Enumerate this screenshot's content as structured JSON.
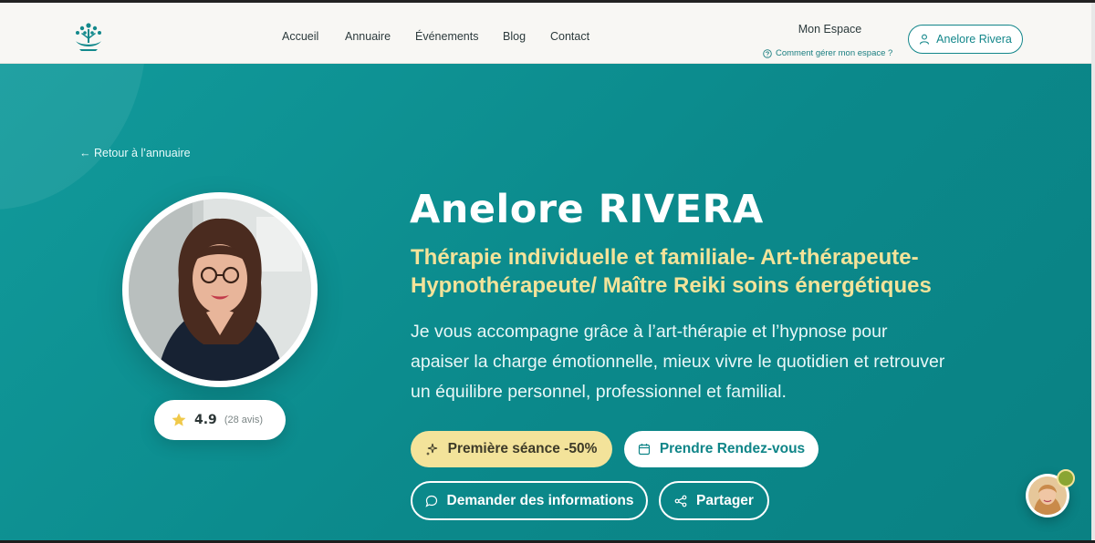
{
  "nav": {
    "links": [
      "Accueil",
      "Annuaire",
      "Événements",
      "Blog",
      "Contact"
    ],
    "espace_title": "Mon Espace",
    "espace_help": "Comment gérer mon espace ?",
    "user_button": "Anelore Rivera"
  },
  "hero": {
    "back_link": "← Retour à l’annuaire",
    "name": "Anelore RIVERA",
    "specialty": "Thérapie individuelle et familiale- Art-thérapeute- Hypnothérapeute/ Maître Reiki soins énergétiques",
    "description": "Je vous accompagne grâce à l’art-thérapie et l’hypnose pour apaiser la charge émotionnelle, mieux vivre le quotidien et retrouver un équilibre personnel, professionnel et familial.",
    "rating": {
      "value": "4.9",
      "count": "(28 avis)"
    },
    "buttons": {
      "offer": "Première séance -50%",
      "appointment": "Prendre Rendez-vous",
      "info": "Demander des informations",
      "share": "Partager"
    }
  },
  "colors": {
    "teal": "#0c8f91",
    "accent_yellow": "#f3e39a",
    "nav_bg": "#f8f7f4"
  },
  "icons": {
    "logo": "lotus-tree-logo",
    "help": "question-circle-icon",
    "user": "user-icon",
    "star": "star-icon",
    "offer": "sparkles-icon",
    "appointment": "calendar-icon",
    "info": "chat-bubble-icon",
    "share": "share-icon"
  }
}
